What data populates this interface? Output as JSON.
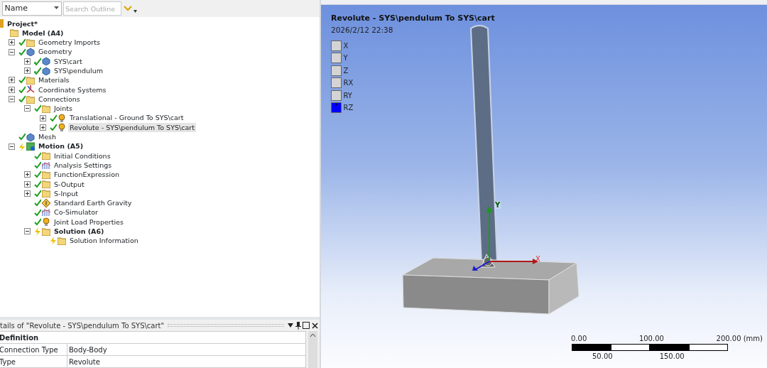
{
  "outline_toolbar": {
    "filter_dropdown": "Name",
    "search": {
      "placeholder": "Search Outline"
    }
  },
  "tree": [
    {
      "label": "Project*",
      "bold": true,
      "kind": "project",
      "children": [
        {
          "label": "Model (A4)",
          "bold": true,
          "kind": "folder",
          "children": [
            {
              "label": "Geometry Imports",
              "kind": "folder",
              "solved": true,
              "pending": false,
              "expanded": false
            },
            {
              "label": "Geometry",
              "kind": "part",
              "solved": true,
              "pending": false,
              "expanded": true,
              "children": [
                {
                  "label": "SYS\\cart",
                  "kind": "part",
                  "solved": true,
                  "pending": false,
                  "partial": true,
                  "expanded": false
                },
                {
                  "label": "SYS\\pendulum",
                  "kind": "part",
                  "solved": true,
                  "pending": false,
                  "partial": true,
                  "expanded": false
                }
              ]
            },
            {
              "label": "Materials",
              "kind": "folder",
              "solved": true,
              "pending": false,
              "expanded": false
            },
            {
              "label": "Coordinate Systems",
              "kind": "axes",
              "solved": true,
              "pending": false,
              "expanded": false
            },
            {
              "label": "Connections",
              "kind": "folder",
              "solved": true,
              "pending": false,
              "expanded": true,
              "children": [
                {
                  "label": "Joints",
                  "kind": "folder",
                  "solved": true,
                  "pending": false,
                  "expanded": true,
                  "children": [
                    {
                      "label": "Translational - Ground To SYS\\cart",
                      "kind": "joint",
                      "solved": true,
                      "pending": false,
                      "expanded": false,
                      "selected": false
                    },
                    {
                      "label": "Revolute - SYS\\pendulum To SYS\\cart",
                      "kind": "joint",
                      "solved": true,
                      "pending": false,
                      "expanded": false,
                      "selected": true
                    }
                  ]
                }
              ]
            },
            {
              "label": "Mesh",
              "kind": "part",
              "solved": true,
              "pending": false
            },
            {
              "label": "Motion (A5)",
              "bold": true,
              "kind": "analysis",
              "solved": false,
              "pending": true,
              "expanded": true,
              "children": [
                {
                  "label": "Initial Conditions",
                  "kind": "folder",
                  "solved": true,
                  "pending": false
                },
                {
                  "label": "Analysis Settings",
                  "kind": "settings",
                  "solved": true,
                  "pending": false
                },
                {
                  "label": "FunctionExpression",
                  "kind": "folder",
                  "solved": true,
                  "pending": false,
                  "expanded": false
                },
                {
                  "label": "S-Output",
                  "kind": "folder",
                  "solved": true,
                  "pending": false,
                  "expanded": false
                },
                {
                  "label": "S-Input",
                  "kind": "folder",
                  "solved": true,
                  "pending": false,
                  "expanded": false
                },
                {
                  "label": "Standard Earth Gravity",
                  "kind": "gravity",
                  "solved": true,
                  "pending": false
                },
                {
                  "label": "Co-Simulator",
                  "kind": "settings",
                  "solved": true,
                  "pending": false
                },
                {
                  "label": "Joint Load Properties",
                  "kind": "joint",
                  "solved": true,
                  "pending": false
                },
                {
                  "label": "Solution (A6)",
                  "bold": true,
                  "kind": "folder",
                  "solved": false,
                  "pending": true,
                  "expanded": true,
                  "children": [
                    {
                      "label": "Solution Information",
                      "kind": "folder",
                      "solved": false,
                      "pending": true
                    }
                  ]
                }
              ]
            }
          ]
        }
      ]
    }
  ],
  "details": {
    "title": "tails of \"Revolute - SYS\\pendulum To SYS\\cart\"",
    "section": "Definition",
    "rows": [
      {
        "name": "Connection Type",
        "value": "Body-Body"
      },
      {
        "name": "Type",
        "value": "Revolute"
      }
    ]
  },
  "viewport": {
    "title": "Revolute - SYS\\pendulum To SYS\\cart",
    "timestamp": "2026/2/12 22:38",
    "dof_legend": [
      {
        "label": "X",
        "selected": false
      },
      {
        "label": "Y",
        "selected": false
      },
      {
        "label": "Z",
        "selected": false
      },
      {
        "label": "RX",
        "selected": false
      },
      {
        "label": "RY",
        "selected": false
      },
      {
        "label": "RZ",
        "selected": true,
        "symbol": "*"
      }
    ],
    "triad": {
      "x_label": "X",
      "y_label": "Y"
    },
    "scale_bar": {
      "top_labels": [
        "0.00",
        "100.00",
        "200.00 (mm)"
      ],
      "bottom_labels": [
        "50.00",
        "150.00"
      ]
    }
  }
}
